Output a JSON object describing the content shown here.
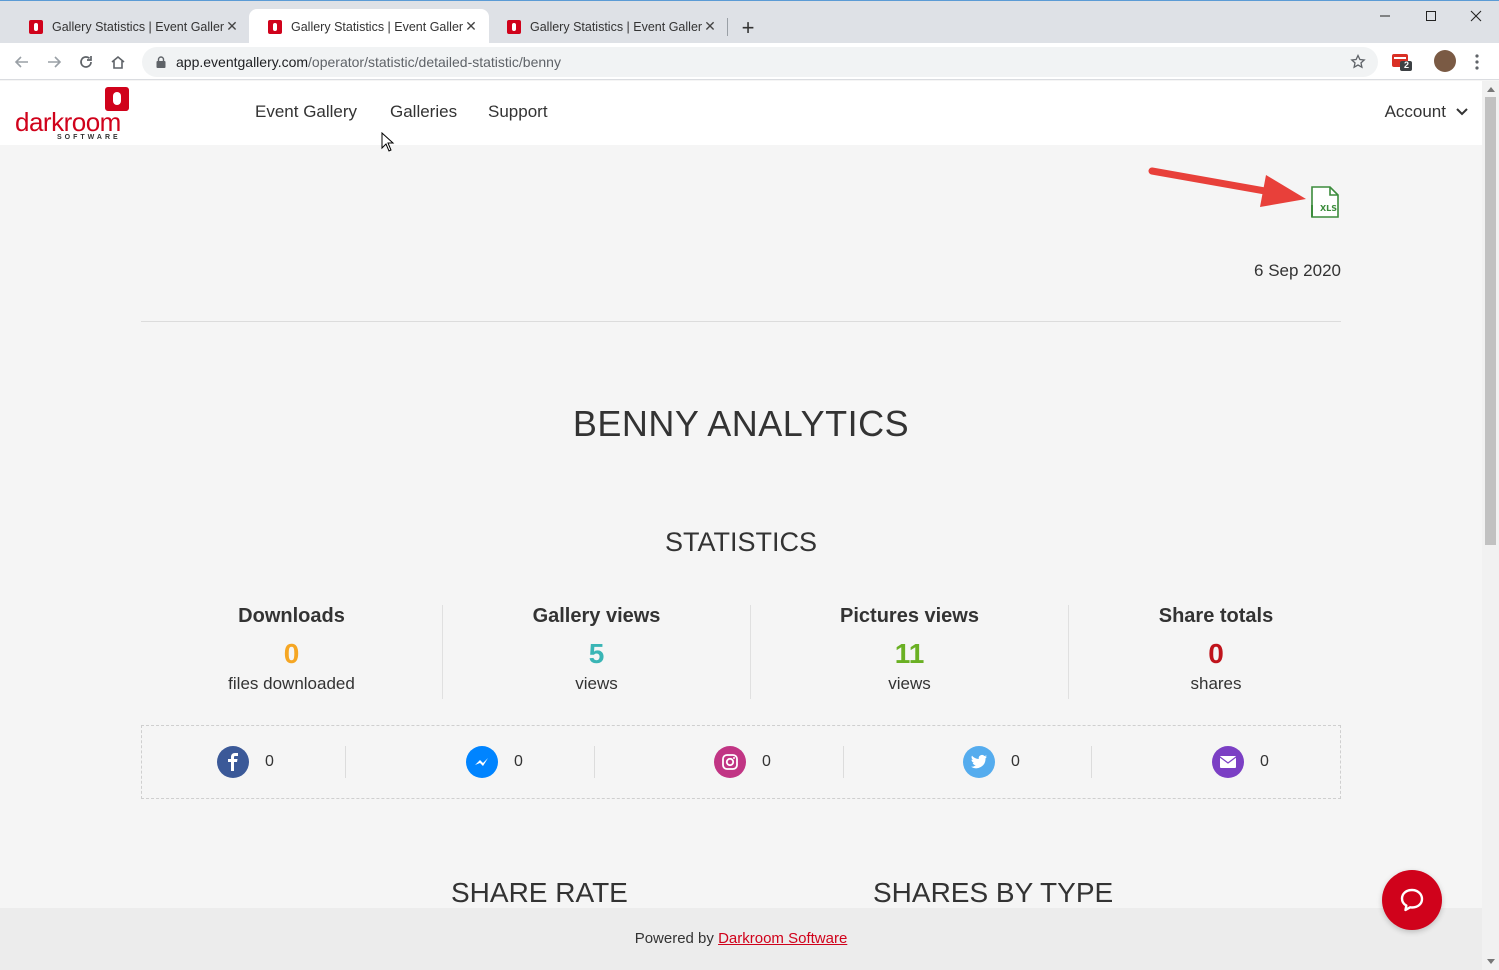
{
  "browser": {
    "tabs": [
      {
        "title": "Gallery Statistics | Event Gallery",
        "active": false
      },
      {
        "title": "Gallery Statistics | Event Gallery",
        "active": true
      },
      {
        "title": "Gallery Statistics | Event Gallery",
        "active": false
      }
    ],
    "new_tab_label": "+",
    "url_host": "app.eventgallery.com",
    "url_path": "/operator/statistic/detailed-statistic/benny",
    "extension_badge": "2"
  },
  "header": {
    "logo_text": "darkroom",
    "logo_sub": "SOFTWARE",
    "nav": [
      {
        "label": "Event Gallery"
      },
      {
        "label": "Galleries"
      },
      {
        "label": "Support"
      }
    ],
    "account_label": "Account"
  },
  "export": {
    "icon_text": "XLS",
    "date": "6 Sep 2020"
  },
  "page_title": "BENNY ANALYTICS",
  "section_title": "STATISTICS",
  "stats": [
    {
      "label": "Downloads",
      "value": "0",
      "unit": "files downloaded",
      "color": "#f5a623"
    },
    {
      "label": "Gallery views",
      "value": "5",
      "unit": "views",
      "color": "#3ab5b5"
    },
    {
      "label": "Pictures views",
      "value": "11",
      "unit": "views",
      "color": "#6ab023"
    },
    {
      "label": "Share totals",
      "value": "0",
      "unit": "shares",
      "color": "#c0141c"
    }
  ],
  "shares": [
    {
      "icon": "facebook-icon",
      "value": "0",
      "color": "#3b5998"
    },
    {
      "icon": "messenger-icon",
      "value": "0",
      "color": "#0084ff"
    },
    {
      "icon": "instagram-icon",
      "value": "0",
      "color": "#c13584"
    },
    {
      "icon": "twitter-icon",
      "value": "0",
      "color": "#55acee"
    },
    {
      "icon": "email-icon",
      "value": "0",
      "color": "#7b3fc4"
    }
  ],
  "subsections": {
    "share_rate": "SHARE RATE",
    "shares_by_type": "SHARES BY TYPE"
  },
  "footer": {
    "prefix": "Powered by ",
    "link": "Darkroom Software"
  }
}
